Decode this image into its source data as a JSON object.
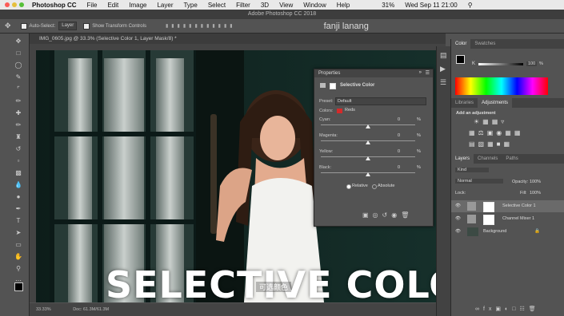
{
  "menubar": {
    "app": "Photoshop CC",
    "items": [
      "File",
      "Edit",
      "Image",
      "Layer",
      "Type",
      "Select",
      "Filter",
      "3D",
      "View",
      "Window",
      "Help"
    ],
    "battery": "31%",
    "clock": "Wed Sep 11 21:00"
  },
  "window": {
    "title": "Adobe Photoshop CC 2018",
    "user": "fanji lanang"
  },
  "options": {
    "auto_select_label": "Auto-Select:",
    "auto_select_value": "Layer",
    "transform_label": "Show Transform Controls"
  },
  "document": {
    "tab": "IMG_0605.jpg @ 33.3% (Selective Color 1, Layer Mask/8) *",
    "zoom": "33.33%",
    "doc_info": "Doc: 61.3M/61.3M"
  },
  "properties": {
    "title": "Properties",
    "panel_name": "Selective Color",
    "preset_label": "Preset:",
    "preset_value": "Default",
    "colors_label": "Colors:",
    "colors_value": "Reds",
    "colors_swatch": "#d42a2a",
    "sliders": [
      {
        "label": "Cyan:",
        "value": "0",
        "unit": "%"
      },
      {
        "label": "Magenta:",
        "value": "0",
        "unit": "%"
      },
      {
        "label": "Yellow:",
        "value": "0",
        "unit": "%"
      },
      {
        "label": "Black:",
        "value": "0",
        "unit": "%"
      }
    ],
    "method_relative": "Relative",
    "method_absolute": "Absolute"
  },
  "color_panel": {
    "tabs": [
      "Color",
      "Swatches"
    ],
    "k_label": "K",
    "k_value": "100",
    "k_unit": "%"
  },
  "adjust_panel": {
    "tabs": [
      "Libraries",
      "Adjustments"
    ],
    "add_label": "Add an adjustment"
  },
  "layers_panel": {
    "tabs": [
      "Layers",
      "Channels",
      "Paths"
    ],
    "kind": "Kind",
    "blend": "Normal",
    "opacity_label": "Opacity:",
    "opacity_value": "100%",
    "lock_label": "Lock:",
    "fill_label": "Fill:",
    "fill_value": "100%",
    "layers": [
      "Selective Color 1",
      "Channel Mixer 1",
      "Background"
    ]
  },
  "caption": {
    "main": "SELECTIVE COLOR",
    "sub": "可选颜色"
  }
}
